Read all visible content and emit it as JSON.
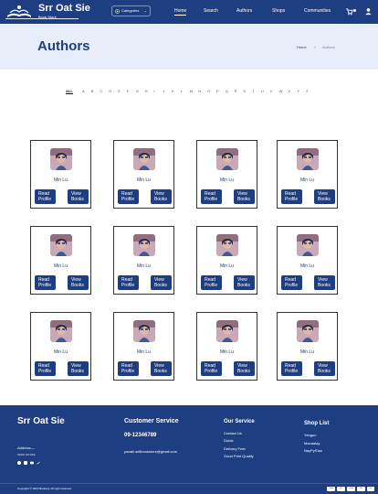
{
  "header": {
    "brand": "Srr Oat Sie",
    "brand_sub": "Book Store",
    "categories_label": "Categories",
    "nav": [
      "Home",
      "Search",
      "Authors",
      "Shops",
      "Communities"
    ],
    "active_nav": "Home"
  },
  "hero": {
    "title": "Authors",
    "breadcrumb": [
      "Home",
      "»",
      "Authors"
    ]
  },
  "alphabet": [
    "ALL",
    "A",
    "B",
    "C",
    "D",
    "E",
    "F",
    "G",
    "H",
    "I",
    "J",
    "K",
    "L",
    "M",
    "N",
    "O",
    "P",
    "Q",
    "R",
    "S",
    "T",
    "U",
    "V",
    "W",
    "X",
    "Y",
    "Z"
  ],
  "cards": {
    "read_label": "Read Profile",
    "view_label": "View Books",
    "authors": [
      "Min Lu",
      "Min Lu",
      "Min Lu",
      "Min Lu",
      "Min Lu",
      "Min Lu",
      "Min Lu",
      "Min Lu",
      "Min Lu",
      "Min Lu",
      "Min Lu",
      "Min Lu"
    ]
  },
  "footer": {
    "brand": "Srr Oat Sie",
    "address_label": "Address—",
    "address_small": "XXXX XX XXX",
    "customer_service": {
      "title": "Customer Service",
      "phone": "09-12346789",
      "email": "parabi.sellbookstore@gmail.com"
    },
    "our_service": {
      "title": "Our Service",
      "links": [
        "Contact Us",
        "Guide",
        "Delivery Free",
        "Good Print Quality"
      ]
    },
    "shop_list": {
      "title": "Shop List",
      "links": [
        "Yangon",
        "Mandalay",
        "NayPyiTaw"
      ]
    },
    "copyright": "Copyright © 2022 Bookery. All right reserved.",
    "payments": [
      "VISA",
      "MC",
      "VISA",
      "MC",
      "MC"
    ]
  },
  "colors": {
    "brand_blue": "#1f3e82",
    "hero_bg": "#e8eef9"
  }
}
